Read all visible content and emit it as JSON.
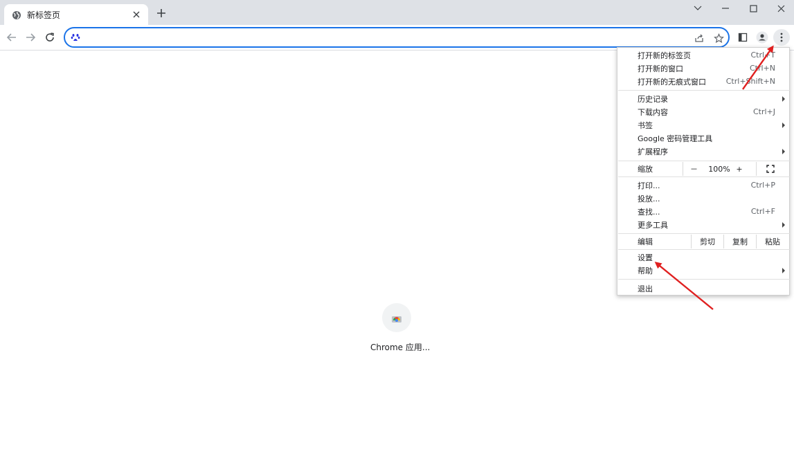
{
  "browser": {
    "tab_title": "新标签页",
    "address_value": "",
    "address_placeholder": ""
  },
  "content": {
    "shortcut_label": "Chrome 应用..."
  },
  "menu": {
    "group1": [
      {
        "label": "打开新的标签页",
        "shortcut": "Ctrl+T"
      },
      {
        "label": "打开新的窗口",
        "shortcut": "Ctrl+N"
      },
      {
        "label": "打开新的无痕式窗口",
        "shortcut": "Ctrl+Shift+N"
      }
    ],
    "group2": [
      {
        "label": "历史记录",
        "shortcut": ""
      },
      {
        "label": "下载内容",
        "shortcut": "Ctrl+J"
      },
      {
        "label": "书签",
        "shortcut": ""
      },
      {
        "label": "Google 密码管理工具",
        "shortcut": ""
      },
      {
        "label": "扩展程序",
        "shortcut": ""
      }
    ],
    "zoom": {
      "label": "缩放",
      "minus": "－",
      "value": "100%",
      "plus": "+"
    },
    "group3": [
      {
        "label": "打印...",
        "shortcut": "Ctrl+P"
      },
      {
        "label": "投放...",
        "shortcut": ""
      },
      {
        "label": "查找...",
        "shortcut": "Ctrl+F"
      },
      {
        "label": "更多工具",
        "shortcut": ""
      }
    ],
    "edit": {
      "label": "编辑",
      "cut": "剪切",
      "copy": "复制",
      "paste": "粘贴"
    },
    "group4": [
      {
        "label": "设置",
        "shortcut": ""
      },
      {
        "label": "帮助",
        "shortcut": ""
      }
    ],
    "exit": {
      "label": "退出"
    }
  },
  "colors": {
    "accent": "#1a73e8",
    "annotation": "#e02020",
    "tabstrip": "#dee1e6"
  },
  "icons": [
    "globe-icon",
    "close-icon",
    "plus-icon",
    "chevron-down-icon",
    "minimize-icon",
    "maximize-icon",
    "window-close-icon",
    "back-icon",
    "forward-icon",
    "reload-icon",
    "baidu-paw-icon",
    "share-icon",
    "star-icon",
    "side-panel-icon",
    "profile-icon",
    "more-vert-icon",
    "fullscreen-icon",
    "chrome-apps-icon"
  ]
}
